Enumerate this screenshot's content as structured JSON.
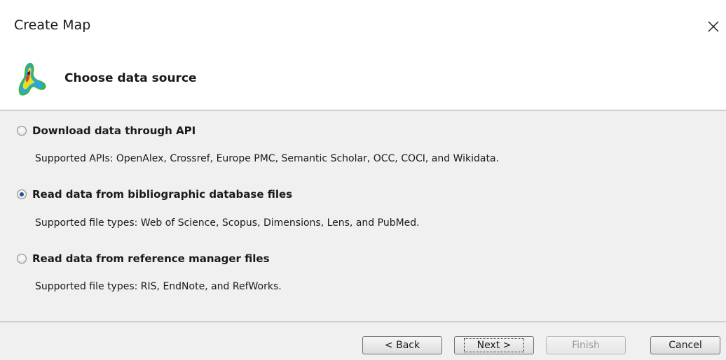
{
  "window": {
    "title": "Create Map",
    "close_icon": "close-icon"
  },
  "header": {
    "logo_icon": "vosviewer-logo-icon",
    "title": "Choose data source"
  },
  "options": [
    {
      "label": "Download data through API",
      "description": "Supported APIs: OpenAlex, Crossref, Europe PMC, Semantic Scholar, OCC, COCI, and Wikidata.",
      "selected": false
    },
    {
      "label": "Read data from bibliographic database files",
      "description": "Supported file types: Web of Science, Scopus, Dimensions, Lens, and PubMed.",
      "selected": true
    },
    {
      "label": "Read data from reference manager files",
      "description": "Supported file types: RIS, EndNote, and RefWorks.",
      "selected": false
    }
  ],
  "buttons": {
    "back": "< Back",
    "next": "Next >",
    "finish": "Finish",
    "cancel": "Cancel"
  },
  "colors": {
    "radio_selected": "#2a4f8a",
    "panel_background": "#f0f0f0",
    "disabled_text": "#9a9a9a"
  }
}
